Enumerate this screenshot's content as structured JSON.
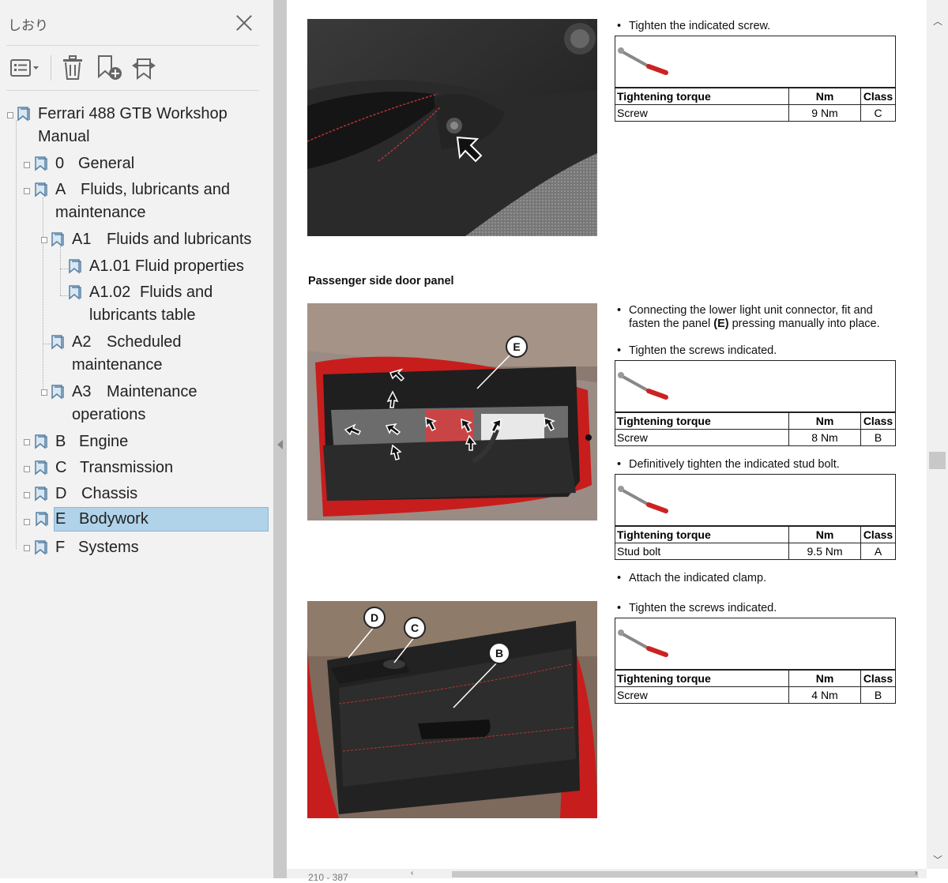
{
  "sidebar": {
    "title": "しおり",
    "toolbar": {
      "options": "options-menu",
      "delete": "delete",
      "new_bookmark": "new-bookmark",
      "expand": "expand-bookmark"
    },
    "tree": {
      "root": "Ferrari 488 GTB Workshop Manual",
      "items": [
        {
          "num": "0",
          "label": "General"
        },
        {
          "num": "A",
          "label": "Fluids, lubricants and maintenance"
        },
        {
          "num": "A1",
          "label": "Fluids and lubricants"
        },
        {
          "num": "A1.01",
          "label": "Fluid properties"
        },
        {
          "num": "A1.02",
          "label": "Fluids and lubricants table"
        },
        {
          "num": "A2",
          "label": "Scheduled maintenance"
        },
        {
          "num": "A3",
          "label": "Maintenance operations"
        },
        {
          "num": "B",
          "label": "Engine"
        },
        {
          "num": "C",
          "label": "Transmission"
        },
        {
          "num": "D",
          "label": "Chassis"
        },
        {
          "num": "E",
          "label": "Bodywork"
        },
        {
          "num": "F",
          "label": "Systems"
        }
      ],
      "selected": "E"
    }
  },
  "document": {
    "section1": {
      "bullets": [
        "Tighten the indicated screw."
      ],
      "torque": {
        "h1": "Tightening torque",
        "h2": "Nm",
        "h3": "Class",
        "item": "Screw",
        "nm": "9 Nm",
        "cls": "C"
      }
    },
    "heading": "Passenger side door panel",
    "section2": {
      "bullet1_pre": "Connecting the lower light unit connector, fit and fasten the panel ",
      "bullet1_bold": "(E)",
      "bullet1_post": " pressing manually into place.",
      "bullet2": "Tighten the screws indicated.",
      "torque": {
        "h1": "Tightening torque",
        "h2": "Nm",
        "h3": "Class",
        "item": "Screw",
        "nm": "8 Nm",
        "cls": "B"
      },
      "callout": "E"
    },
    "section3": {
      "bullet": "Definitively tighten the indicated stud bolt.",
      "torque": {
        "h1": "Tightening torque",
        "h2": "Nm",
        "h3": "Class",
        "item": "Stud bolt",
        "nm": "9.5 Nm",
        "cls": "A"
      },
      "bullet_after": "Attach the indicated clamp."
    },
    "section4": {
      "bullet": "Tighten the screws indicated.",
      "torque": {
        "h1": "Tightening torque",
        "h2": "Nm",
        "h3": "Class",
        "item": "Screw",
        "nm": "4 Nm",
        "cls": "B"
      },
      "callouts": [
        "D",
        "C",
        "B"
      ]
    },
    "page_label": "210 - 387"
  },
  "colors": {
    "selected_bg": "#b0d3e9",
    "splitter": "#c9c9c9",
    "sidebar_bg": "#f2f2f2"
  }
}
